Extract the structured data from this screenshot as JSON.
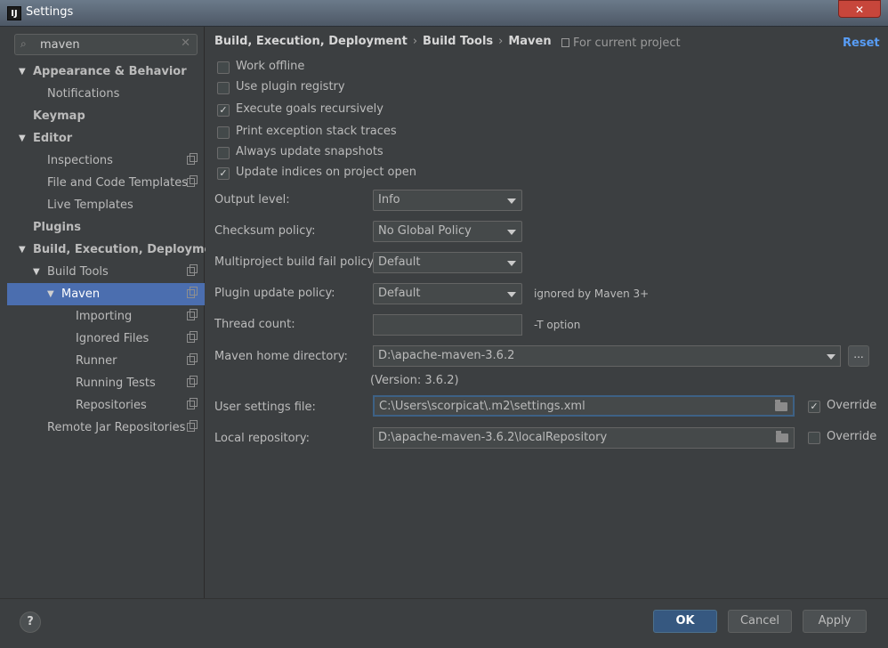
{
  "window": {
    "title": "Settings",
    "app_icon_text": "IJ",
    "close_glyph": "✕"
  },
  "search": {
    "value": "maven",
    "icon": "search-icon",
    "clear_glyph": "✕"
  },
  "tree": [
    {
      "label": "Appearance & Behavior",
      "bold": true,
      "arrow": "▼",
      "indent": 0,
      "copy": false
    },
    {
      "label": "Notifications",
      "bold": false,
      "arrow": "",
      "indent": 1,
      "copy": false
    },
    {
      "label": "Keymap",
      "bold": true,
      "arrow": "",
      "indent": 0,
      "copy": false
    },
    {
      "label": "Editor",
      "bold": true,
      "arrow": "▼",
      "indent": 0,
      "copy": false
    },
    {
      "label": "Inspections",
      "bold": false,
      "arrow": "",
      "indent": 1,
      "copy": true
    },
    {
      "label": "File and Code Templates",
      "bold": false,
      "arrow": "",
      "indent": 1,
      "copy": true
    },
    {
      "label": "Live Templates",
      "bold": false,
      "arrow": "",
      "indent": 1,
      "copy": false
    },
    {
      "label": "Plugins",
      "bold": true,
      "arrow": "",
      "indent": 0,
      "copy": false
    },
    {
      "label": "Build, Execution, Deployment",
      "bold": true,
      "arrow": "▼",
      "indent": 0,
      "copy": false
    },
    {
      "label": "Build Tools",
      "bold": false,
      "arrow": "▼",
      "indent": 1,
      "copy": true
    },
    {
      "label": "Maven",
      "bold": false,
      "arrow": "▼",
      "indent": 2,
      "copy": true,
      "selected": true
    },
    {
      "label": "Importing",
      "bold": false,
      "arrow": "",
      "indent": 3,
      "copy": true
    },
    {
      "label": "Ignored Files",
      "bold": false,
      "arrow": "",
      "indent": 3,
      "copy": true
    },
    {
      "label": "Runner",
      "bold": false,
      "arrow": "",
      "indent": 3,
      "copy": true
    },
    {
      "label": "Running Tests",
      "bold": false,
      "arrow": "",
      "indent": 3,
      "copy": true
    },
    {
      "label": "Repositories",
      "bold": false,
      "arrow": "",
      "indent": 3,
      "copy": true
    },
    {
      "label": "Remote Jar Repositories",
      "bold": false,
      "arrow": "",
      "indent": 1,
      "copy": true
    }
  ],
  "breadcrumb": {
    "items": [
      "Build, Execution, Deployment",
      "Build Tools",
      "Maven"
    ],
    "separator": "›"
  },
  "project_note": "For current project",
  "reset_label": "Reset",
  "checkboxes": [
    {
      "label": "Work offline",
      "checked": false
    },
    {
      "label": "Use plugin registry",
      "checked": false
    },
    {
      "label": "Execute goals recursively",
      "checked": true
    },
    {
      "label": "Print exception stack traces",
      "checked": false
    },
    {
      "label": "Always update snapshots",
      "checked": false
    },
    {
      "label": "Update indices on project open",
      "checked": true
    }
  ],
  "check_glyph": "✓",
  "form": {
    "output_level": {
      "label": "Output level:",
      "value": "Info"
    },
    "checksum_policy": {
      "label": "Checksum policy:",
      "value": "No Global Policy"
    },
    "multiproject_fail_policy": {
      "label": "Multiproject build fail policy:",
      "value": "Default"
    },
    "plugin_update_policy": {
      "label": "Plugin update policy:",
      "value": "Default",
      "hint": "ignored by Maven 3+"
    },
    "thread_count": {
      "label": "Thread count:",
      "value": "",
      "hint": "-T option"
    },
    "maven_home": {
      "label": "Maven home directory:",
      "value": "D:\\apache-maven-3.6.2",
      "browse": "..."
    },
    "version": "(Version: 3.6.2)",
    "user_settings": {
      "label": "User settings file:",
      "value": "C:\\Users\\scorpicat\\.m2\\settings.xml",
      "override_label": "Override",
      "override_checked": true
    },
    "local_repository": {
      "label": "Local repository:",
      "value": "D:\\apache-maven-3.6.2\\localRepository",
      "override_label": "Override",
      "override_checked": false
    }
  },
  "footer": {
    "help": "?",
    "ok": "OK",
    "cancel": "Cancel",
    "apply": "Apply"
  }
}
